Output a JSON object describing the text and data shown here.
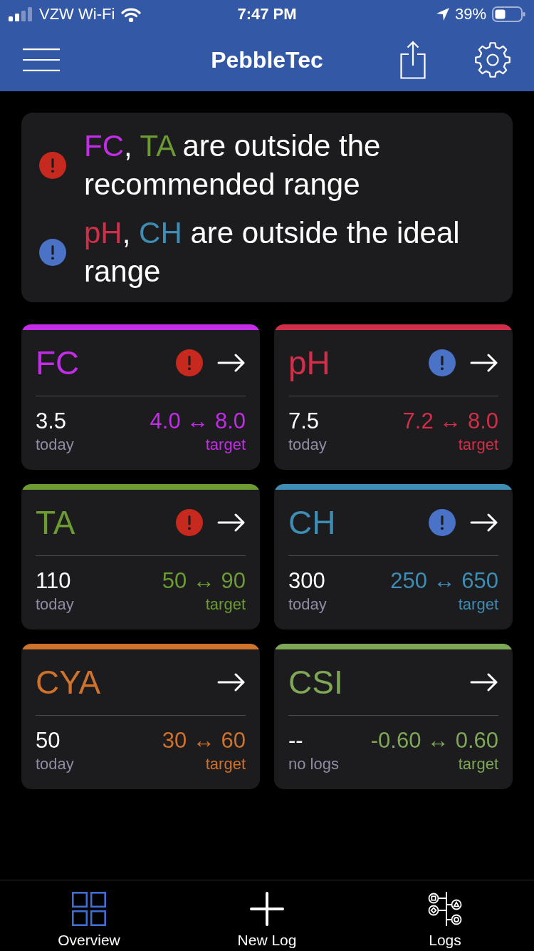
{
  "status_bar": {
    "carrier": "VZW Wi-Fi",
    "time": "7:47 PM",
    "battery": "39%"
  },
  "nav_bar": {
    "title": "PebbleTec"
  },
  "alerts": [
    {
      "kind": "error",
      "segments": [
        {
          "text": "FC",
          "color": "#c42de7"
        },
        {
          "text": ", "
        },
        {
          "text": "TA",
          "color": "#6b9b32"
        },
        {
          "text": " are outside the recommended range"
        }
      ]
    },
    {
      "kind": "warning",
      "segments": [
        {
          "text": "pH",
          "color": "#d12f49"
        },
        {
          "text": ", "
        },
        {
          "text": "CH",
          "color": "#3e8db5"
        },
        {
          "text": " are outside the ideal range"
        }
      ]
    }
  ],
  "cards": [
    {
      "name": "FC",
      "color": "#c42de7",
      "kind": "error",
      "value": "3.5",
      "value_label": "today",
      "range": "4.0 ↔ 8.0",
      "range_label": "target"
    },
    {
      "name": "pH",
      "color": "#d12f49",
      "kind": "warning",
      "value": "7.5",
      "value_label": "today",
      "range": "7.2 ↔ 8.0",
      "range_label": "target"
    },
    {
      "name": "TA",
      "color": "#6b9b32",
      "kind": "error",
      "value": "110",
      "value_label": "today",
      "range": "50 ↔ 90",
      "range_label": "target"
    },
    {
      "name": "CH",
      "color": "#3e8db5",
      "kind": "warning",
      "value": "300",
      "value_label": "today",
      "range": "250 ↔ 650",
      "range_label": "target"
    },
    {
      "name": "CYA",
      "color": "#cf722b",
      "kind": "normal",
      "value": "50",
      "value_label": "today",
      "range": "30 ↔ 60",
      "range_label": "target"
    },
    {
      "name": "CSI",
      "color": "#7ea756",
      "kind": "normal",
      "value": "--",
      "value_label": "no logs",
      "range": "-0.60 ↔ 0.60",
      "range_label": "target"
    }
  ],
  "tab_bar": [
    {
      "kind": "overview",
      "label": "Overview",
      "selected": true
    },
    {
      "kind": "add",
      "label": "New Log",
      "selected": false
    },
    {
      "kind": "logs",
      "label": "Logs",
      "selected": false
    }
  ]
}
